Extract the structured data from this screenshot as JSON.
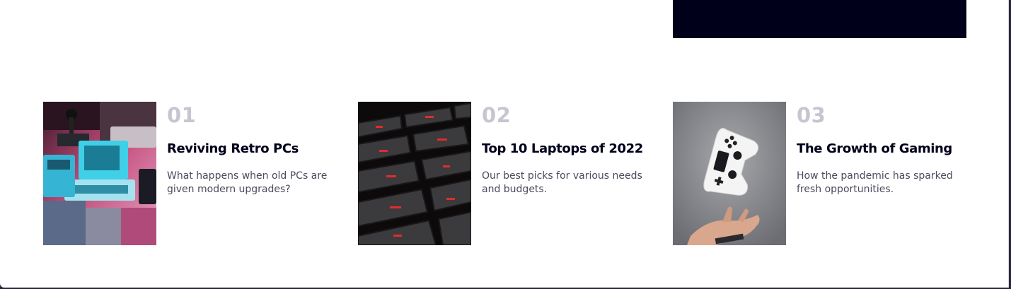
{
  "colors": {
    "banner": "#00001a",
    "number": "#c5c6d0",
    "title": "#00001a",
    "description": "#4a4b5c"
  },
  "articles": [
    {
      "number": "01",
      "title": "Reviving Retro PCs",
      "description": "What happens when old PCs are given modern upgrades?",
      "image_icon": "retro-pc-image"
    },
    {
      "number": "02",
      "title": "Top 10 Laptops of 2022",
      "description": "Our best picks for various needs and budgets.",
      "image_icon": "laptop-keyboard-image"
    },
    {
      "number": "03",
      "title": "The Growth of Gaming",
      "description": "How the pandemic has sparked fresh opportunities.",
      "image_icon": "game-controller-image"
    }
  ]
}
